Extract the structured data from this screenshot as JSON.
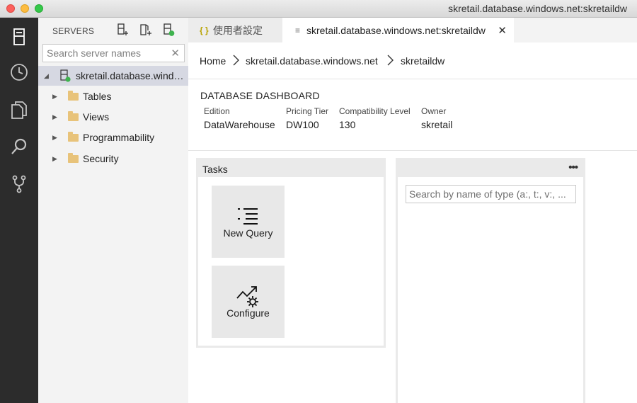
{
  "window": {
    "title": "skretail.database.windows.net:skretaildw"
  },
  "activity_bar": {
    "items": [
      {
        "icon": "servers-icon"
      },
      {
        "icon": "history-icon"
      },
      {
        "icon": "explorer-icon"
      },
      {
        "icon": "search-icon"
      },
      {
        "icon": "source-control-icon"
      }
    ]
  },
  "sidebar": {
    "header": "SERVERS",
    "search_placeholder": "Search server names",
    "clear_glyph": "✕",
    "server": {
      "label": "skretail.database.windows.net",
      "status_color": "#3fb34f"
    },
    "folders": [
      {
        "label": "Tables"
      },
      {
        "label": "Views"
      },
      {
        "label": "Programmability"
      },
      {
        "label": "Security"
      }
    ]
  },
  "tabs": [
    {
      "icon_glyph": "{ }",
      "label": "使用者設定",
      "active": false
    },
    {
      "icon_glyph": "≡",
      "label": "skretail.database.windows.net:skretaildw",
      "active": true,
      "close_glyph": "✕"
    }
  ],
  "breadcrumb": [
    "Home",
    "skretail.database.windows.net",
    "skretaildw"
  ],
  "dashboard": {
    "title": "DATABASE DASHBOARD",
    "properties": [
      {
        "label": "Edition",
        "value": "DataWarehouse"
      },
      {
        "label": "Pricing Tier",
        "value": "DW100"
      },
      {
        "label": "Compatibility Level",
        "value": "130"
      },
      {
        "label": "Owner",
        "value": "skretail"
      }
    ]
  },
  "tasks_widget": {
    "title": "Tasks",
    "tiles": [
      {
        "label": "New Query",
        "icon": "new-query-icon"
      },
      {
        "label": "Configure",
        "icon": "configure-icon"
      }
    ]
  },
  "explorer_widget": {
    "more_glyph": "•••",
    "search_placeholder": "Search by name of type (a:, t:, v:, ..."
  },
  "colors": {
    "activity_bar": "#2c2c2c",
    "sidebar": "#f3f3f3",
    "selected_row": "#d6d8e2",
    "folder": "#e8c37a",
    "json_icon": "#b8a300"
  }
}
